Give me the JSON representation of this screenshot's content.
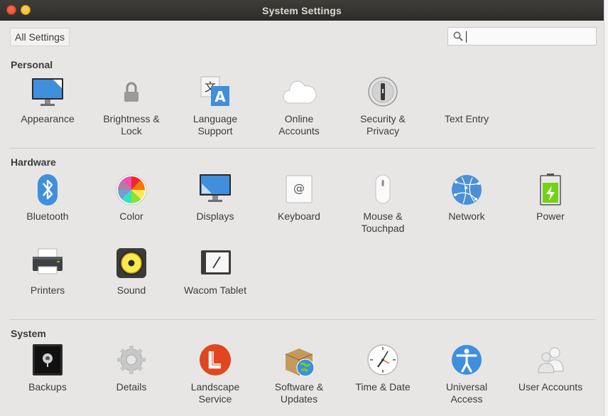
{
  "window": {
    "title": "System Settings"
  },
  "toolbar": {
    "all_settings_label": "All Settings"
  },
  "search": {
    "value": "",
    "placeholder": ""
  },
  "sections": {
    "personal": {
      "title": "Personal",
      "items": [
        "Appearance",
        "Brightness &\nLock",
        "Language\nSupport",
        "Online\nAccounts",
        "Security &\nPrivacy",
        "Text Entry"
      ]
    },
    "hardware": {
      "title": "Hardware",
      "items": [
        "Bluetooth",
        "Color",
        "Displays",
        "Keyboard",
        "Mouse &\nTouchpad",
        "Network",
        "Power",
        "Printers",
        "Sound",
        "Wacom Tablet"
      ]
    },
    "system": {
      "title": "System",
      "items": [
        "Backups",
        "Details",
        "Landscape\nService",
        "Software &\nUpdates",
        "Time & Date",
        "Universal\nAccess",
        "User Accounts"
      ]
    }
  },
  "icons": {
    "accent_blue": "#4a90d9",
    "landscape_red": "#e0461f",
    "power_green": "#73d216"
  }
}
